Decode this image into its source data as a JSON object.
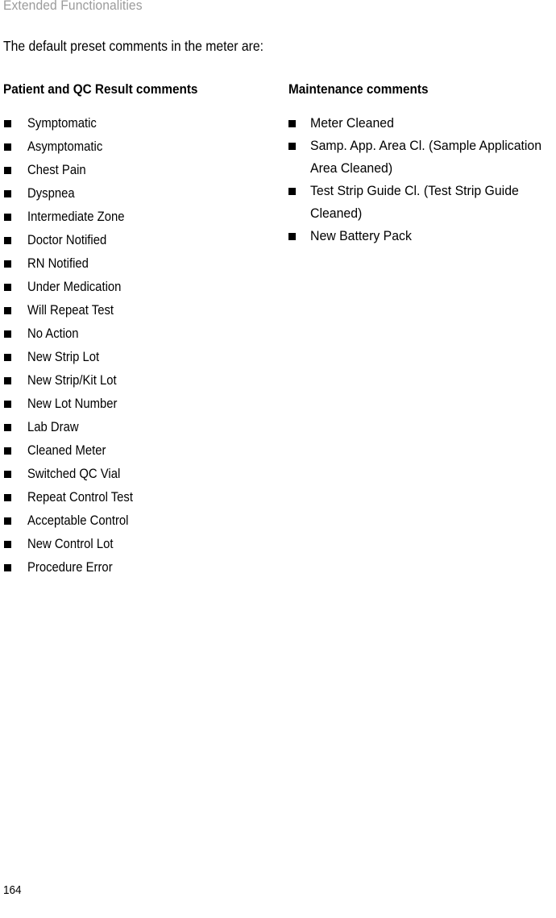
{
  "header": {
    "running_title": "Extended Functionalities"
  },
  "intro": {
    "text": "The default preset comments in the meter are:"
  },
  "columns": {
    "left": {
      "heading": "Patient and QC Result comments",
      "items": [
        "Symptomatic",
        "Asymptomatic",
        "Chest Pain",
        "Dyspnea",
        "Intermediate Zone",
        "Doctor Notified",
        "RN Notified",
        "Under Medication",
        "Will Repeat Test",
        "No Action",
        "New Strip Lot",
        "New Strip/Kit Lot",
        "New Lot Number",
        "Lab Draw",
        "Cleaned Meter",
        "Switched QC Vial",
        "Repeat Control Test",
        "Acceptable Control",
        "New Control Lot",
        "Procedure Error"
      ]
    },
    "right": {
      "heading": "Maintenance comments",
      "items": [
        "Meter Cleaned",
        "Samp. App. Area Cl. (Sample Application Area Cleaned)",
        "Test Strip Guide Cl. (Test Strip Guide Cleaned)",
        "New Battery Pack"
      ]
    }
  },
  "footer": {
    "page_number": "164"
  },
  "colors": {
    "text": "#000000",
    "running_header": "#9b9b9b",
    "bullet": "#000000",
    "background": "#ffffff"
  }
}
